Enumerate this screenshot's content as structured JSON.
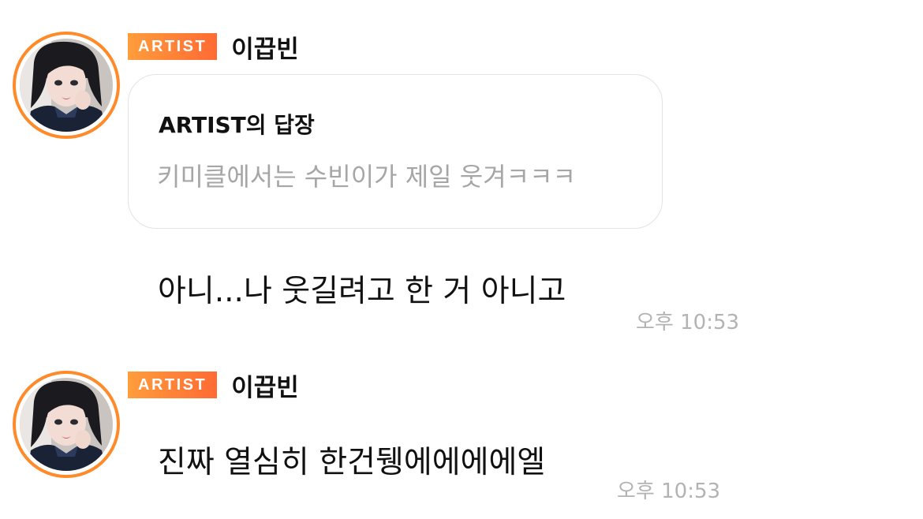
{
  "messages": [
    {
      "badge": "ARTIST",
      "sender": "이끕빈",
      "reply": {
        "title": "ARTIST의 답장",
        "quote": "키미클에서는 수빈이가 제일 웃겨ㅋㅋㅋ"
      },
      "text": "아니...나 웃길려고 한 거 아니고",
      "time": "오후 10:53"
    },
    {
      "badge": "ARTIST",
      "sender": "이끕빈",
      "text": "진짜 열심히 한건뒝에에에에엘",
      "time": "오후 10:53"
    }
  ],
  "colors": {
    "badge_gradient_start": "#ff9d3b",
    "badge_gradient_end": "#ff6a34",
    "avatar_ring": "#ff8a2a",
    "muted_text": "#a6a6a6"
  },
  "icons": {
    "avatar": "profile-photo"
  }
}
